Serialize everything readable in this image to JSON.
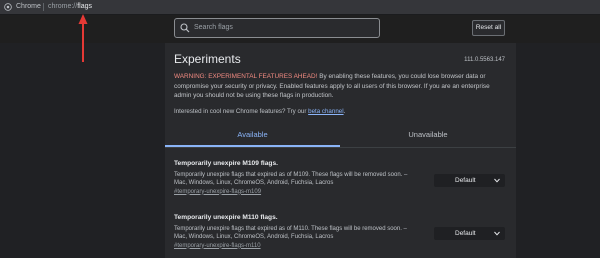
{
  "omnibox": {
    "chip": "Chrome",
    "url_scheme": "chrome://",
    "url_path": "flags"
  },
  "search": {
    "placeholder": "Search flags"
  },
  "reset_button": "Reset all",
  "experiments": {
    "title": "Experiments",
    "version": "111.0.5563.147",
    "warning_strong": "WARNING: EXPERIMENTAL FEATURES AHEAD!",
    "warning_rest": " By enabling these features, you could lose browser data or compromise your security or privacy. Enabled features apply to all users of this browser. If you are an enterprise admin you should not be using these flags in production.",
    "interest_text": "Interested in cool new Chrome features? Try our ",
    "beta_link": "beta channel",
    "interest_end": "."
  },
  "tabs": [
    {
      "label": "Available"
    },
    {
      "label": "Unavailable"
    }
  ],
  "flags": [
    {
      "title": "Temporarily unexpire M109 flags.",
      "description": "Temporarily unexpire flags that expired as of M109. These flags will be removed soon. – Mac, Windows, Linux, ChromeOS, Android, Fuchsia, Lacros",
      "anchor": "#temporary-unexpire-flags-m109",
      "value": "Default"
    },
    {
      "title": "Temporarily unexpire M110 flags.",
      "description": "Temporarily unexpire flags that expired as of M110. These flags will be removed soon. – Mac, Windows, Linux, ChromeOS, Android, Fuchsia, Lacros",
      "anchor": "#temporary-unexpire-flags-m110",
      "value": "Default"
    }
  ],
  "colors": {
    "accent": "#8ab4f8",
    "warning": "#f28b82",
    "annotation_arrow": "#e53935"
  }
}
